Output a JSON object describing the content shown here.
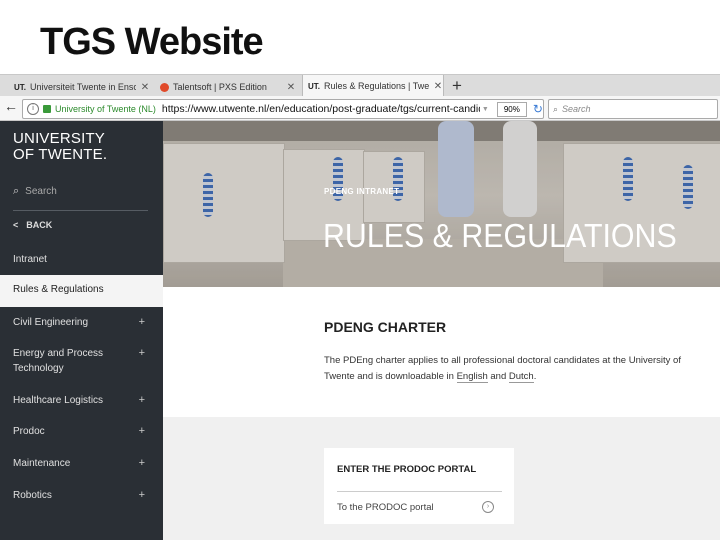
{
  "slide": {
    "title": "TGS Website"
  },
  "browser": {
    "tabs": [
      {
        "favicon": "UT.",
        "label": "Universiteit Twente in Ensch",
        "active": false
      },
      {
        "favicon": "talentsoft-icon",
        "label": "Talentsoft | PXS Edition",
        "active": false
      },
      {
        "favicon": "UT.",
        "label": "Rules & Regulations | Twent",
        "active": true
      }
    ],
    "new_tab": "+",
    "site_identity": "University of Twente (NL)",
    "url": "https://www.utwente.nl/en/education/post-graduate/tgs/current-candidates",
    "zoom": "90%",
    "search_placeholder": "Search"
  },
  "sidebar": {
    "brand_line1": "UNIVERSITY",
    "brand_line2": "OF TWENTE.",
    "search_placeholder": "Search",
    "back_label": "BACK",
    "items": [
      {
        "label": "Intranet",
        "expandable": false,
        "active": false
      },
      {
        "label": "Rules & Regulations",
        "expandable": false,
        "active": true
      },
      {
        "label": "Civil Engineering",
        "expandable": true,
        "active": false
      },
      {
        "label": "Energy and Process Technology",
        "expandable": true,
        "active": false
      },
      {
        "label": "Healthcare Logistics",
        "expandable": true,
        "active": false
      },
      {
        "label": "Prodoc",
        "expandable": true,
        "active": false
      },
      {
        "label": "Maintenance",
        "expandable": true,
        "active": false
      },
      {
        "label": "Robotics",
        "expandable": true,
        "active": false
      }
    ]
  },
  "hero": {
    "kicker": "PDENG INTRANET",
    "title": "RULES & REGULATIONS"
  },
  "main": {
    "section_title": "PDENG CHARTER",
    "body_prefix": "The PDEng charter applies to all professional doctoral candidates at the University of Twente and is downloadable in ",
    "link_english": "English",
    "body_and": " and ",
    "link_dutch": "Dutch",
    "body_suffix": "."
  },
  "card": {
    "title": "ENTER THE PRODOC PORTAL",
    "link": "To the PRODOC portal"
  }
}
